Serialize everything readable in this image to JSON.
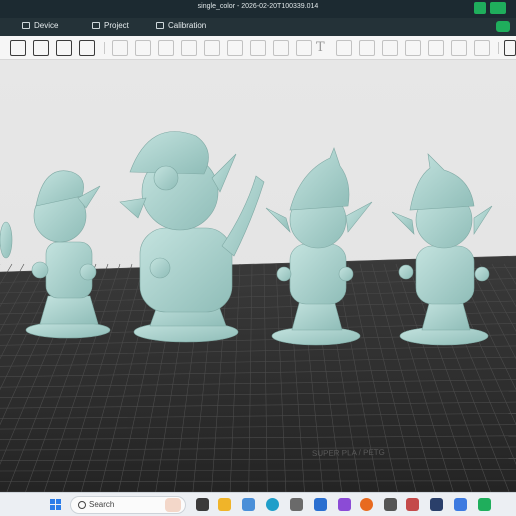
{
  "window": {
    "title": "single_color - 2026-02-20T100339.014"
  },
  "menu": {
    "items": [
      {
        "label": "Device",
        "icon": "monitor-icon"
      },
      {
        "label": "Project",
        "icon": "folder-icon"
      },
      {
        "label": "Calibration",
        "icon": "gear-icon"
      }
    ]
  },
  "toolbar": {
    "text_tool_label": "T"
  },
  "plate": {
    "label": "SUPER PLA / PETG"
  },
  "taskbar": {
    "search_placeholder": "Search"
  },
  "colors": {
    "titlebar": "#1c2a31",
    "menubar": "#243238",
    "accent_green": "#1fae5c",
    "plate": "#2b2b2b",
    "model": "#a9cfcb"
  }
}
